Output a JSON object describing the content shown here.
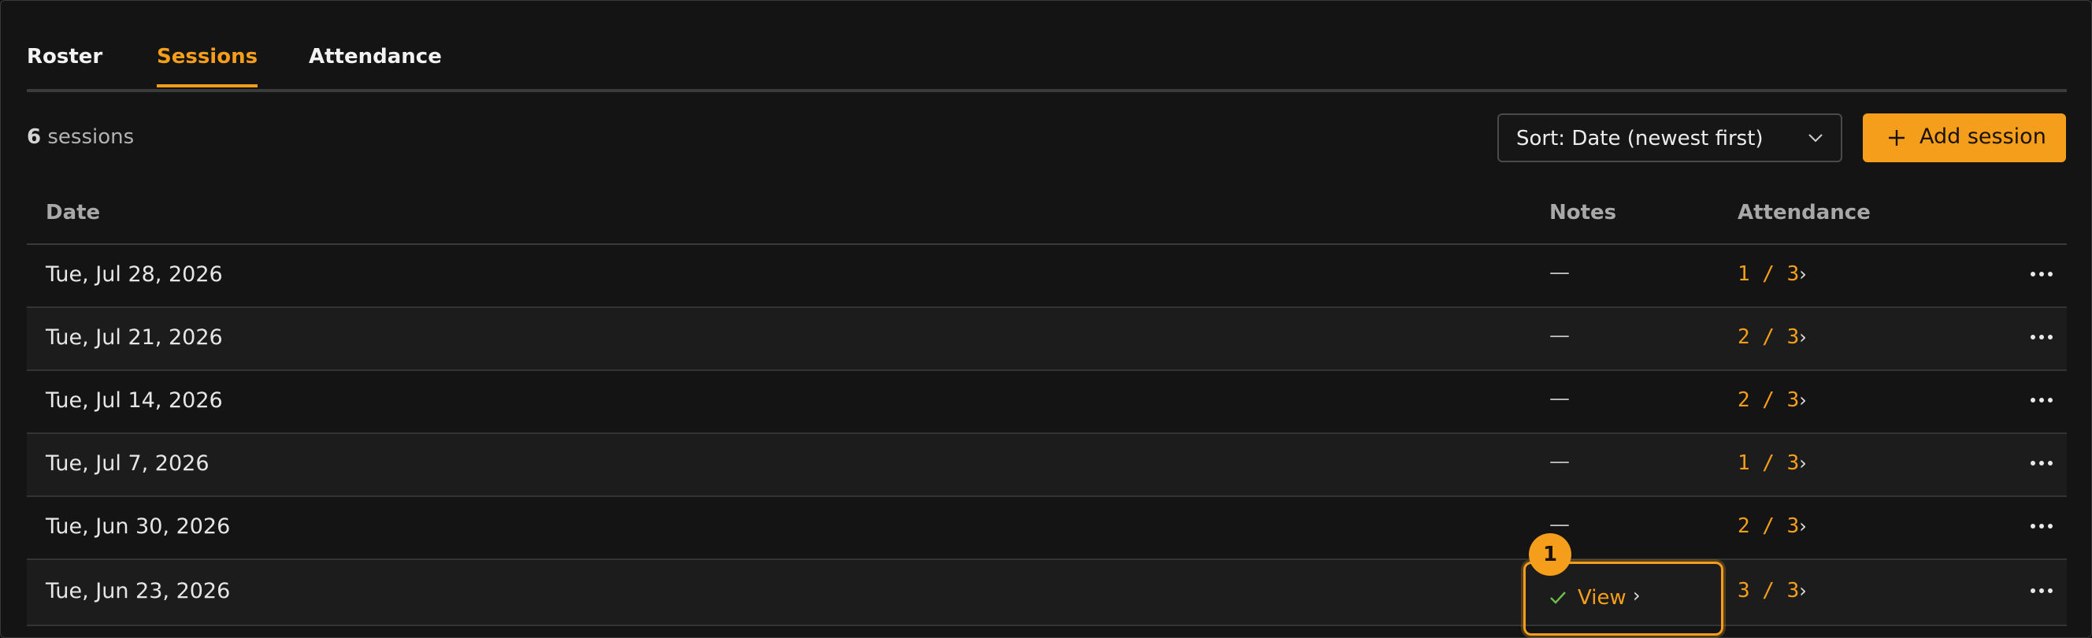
{
  "tabs": [
    {
      "label": "Roster",
      "active": false
    },
    {
      "label": "Sessions",
      "active": true
    },
    {
      "label": "Attendance",
      "active": false
    }
  ],
  "summary": {
    "count": "6",
    "unit": "sessions"
  },
  "sort": {
    "label": "Sort: Date (newest first)"
  },
  "add_button": {
    "label": "Add session"
  },
  "table": {
    "columns": [
      "Date",
      "Notes",
      "Attendance"
    ],
    "rows": [
      {
        "date": "Tue, Jul 28, 2026",
        "notes": "—",
        "attendance": "1 / 3"
      },
      {
        "date": "Tue, Jul 21, 2026",
        "notes": "—",
        "attendance": "2 / 3"
      },
      {
        "date": "Tue, Jul 14, 2026",
        "notes": "—",
        "attendance": "2 / 3"
      },
      {
        "date": "Tue, Jul 7, 2026",
        "notes": "—",
        "attendance": "1 / 3"
      },
      {
        "date": "Tue, Jun 30, 2026",
        "notes": "—",
        "attendance": "2 / 3"
      },
      {
        "date": "Tue, Jun 23, 2026",
        "notes_view_label": "View",
        "attendance": "3 / 3"
      }
    ]
  },
  "callout": {
    "number": "1"
  },
  "colors": {
    "accent": "#f59e1b",
    "background": "#141414",
    "check": "#6cbf4a"
  }
}
